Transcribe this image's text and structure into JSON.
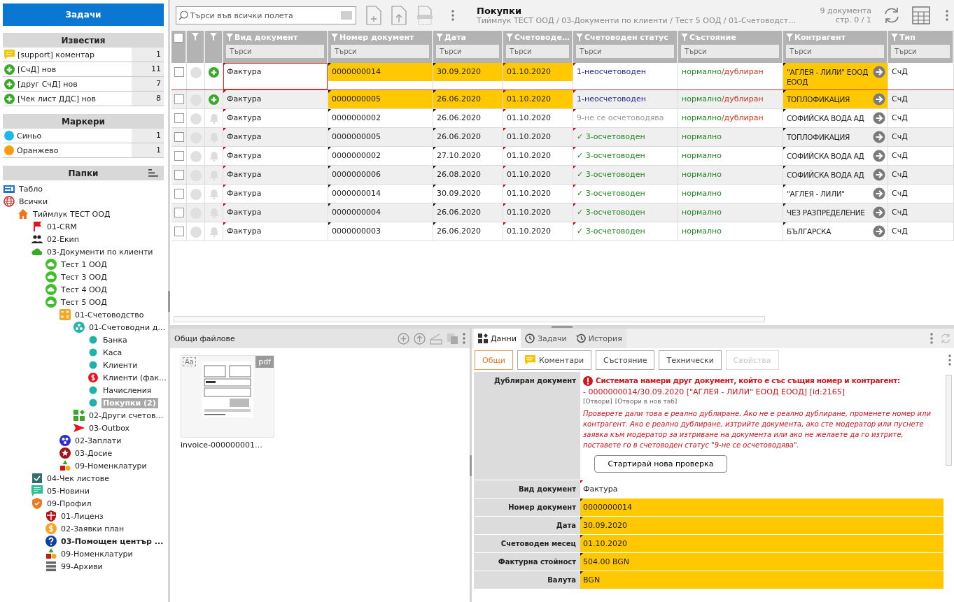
{
  "tasks_button": "Задачи",
  "notifications": {
    "title": "Известия",
    "items": [
      {
        "kind": "comment",
        "label": "[support] коментар",
        "count": "1"
      },
      {
        "kind": "new",
        "label": "[СчД] нов",
        "count": "11"
      },
      {
        "kind": "new",
        "label": "[друг СчД] нов",
        "count": "7"
      },
      {
        "kind": "new",
        "label": "[Чек лист ДДС] нов",
        "count": "8"
      }
    ]
  },
  "markers": {
    "title": "Маркери",
    "items": [
      {
        "label": "Синьо",
        "count": "1",
        "color": "#1ab8ef"
      },
      {
        "label": "Оранжево",
        "count": "1",
        "color": "#ff9a0e"
      }
    ]
  },
  "folders": {
    "title": "Папки",
    "tree": [
      {
        "label": "Табло",
        "kind": "dashboard",
        "selected": false,
        "bold": false
      },
      {
        "label": "Всички",
        "kind": "globe",
        "selected": false,
        "bold": false,
        "children": [
          {
            "label": "Тиймлук ТЕСТ ООД",
            "kind": "home",
            "selected": false,
            "bold": false,
            "children": [
              {
                "label": "01-CRM",
                "kind": "flag",
                "selected": false,
                "bold": false
              },
              {
                "label": "02-Екип",
                "kind": "team",
                "selected": false,
                "bold": false
              },
              {
                "label": "03-Документи по клиенти",
                "kind": "cloud",
                "selected": false,
                "bold": false,
                "children": [
                  {
                    "label": "Тест 1 ООД",
                    "kind": "cloud-badge",
                    "selected": false,
                    "bold": false
                  },
                  {
                    "label": "Тест 3 ООД",
                    "kind": "cloud-badge",
                    "selected": false,
                    "bold": false
                  },
                  {
                    "label": "Тест 4 ООД",
                    "kind": "cloud-badge",
                    "selected": false,
                    "bold": false
                  },
                  {
                    "label": "Тест 5 ООД",
                    "kind": "cloud-badge",
                    "selected": false,
                    "bold": false,
                    "children": [
                      {
                        "label": "01-Счетоводство",
                        "kind": "calculator",
                        "selected": false,
                        "bold": false,
                        "children": [
                          {
                            "label": "01-Счетоводни д…",
                            "kind": "cluster",
                            "selected": false,
                            "bold": false,
                            "children": [
                              {
                                "label": "Банка",
                                "kind": "dot",
                                "selected": false,
                                "bold": false
                              },
                              {
                                "label": "Каса",
                                "kind": "dot",
                                "selected": false,
                                "bold": false
                              },
                              {
                                "label": "Клиенти",
                                "kind": "dot",
                                "selected": false,
                                "bold": false
                              },
                              {
                                "label": "Клиенти (фак…",
                                "kind": "dollar-alert",
                                "selected": false,
                                "bold": false
                              },
                              {
                                "label": "Начисления",
                                "kind": "dot",
                                "selected": false,
                                "bold": false
                              },
                              {
                                "label": "Покупки (2)",
                                "kind": "dot",
                                "selected": true,
                                "bold": true
                              }
                            ]
                          },
                          {
                            "label": "02-Други счетов…",
                            "kind": "blocks",
                            "selected": false,
                            "bold": false
                          },
                          {
                            "label": "03-Outbox",
                            "kind": "send",
                            "selected": false,
                            "bold": false
                          }
                        ]
                      },
                      {
                        "label": "02-Заплати",
                        "kind": "group",
                        "selected": false,
                        "bold": false
                      },
                      {
                        "label": "03-Досие",
                        "kind": "star",
                        "selected": false,
                        "bold": false
                      },
                      {
                        "label": "09-Номенклатури",
                        "kind": "shapes",
                        "selected": false,
                        "bold": false
                      }
                    ]
                  }
                ]
              },
              {
                "label": "04-Чек листове",
                "kind": "checklist",
                "selected": false,
                "bold": false
              },
              {
                "label": "05-Новини",
                "kind": "news",
                "selected": false,
                "bold": false
              },
              {
                "label": "09-Профил",
                "kind": "shield",
                "selected": false,
                "bold": false,
                "children": [
                  {
                    "label": "01-Лиценз",
                    "kind": "shield-red",
                    "selected": false,
                    "bold": false
                  },
                  {
                    "label": "02-Заявки план",
                    "kind": "coin",
                    "selected": false,
                    "bold": false
                  },
                  {
                    "label": "03-Помощен център ...",
                    "kind": "help",
                    "selected": false,
                    "bold": true
                  },
                  {
                    "label": "09-Номенклатури",
                    "kind": "shapes",
                    "selected": false,
                    "bold": false
                  },
                  {
                    "label": "99-Архиви",
                    "kind": "archive",
                    "selected": false,
                    "bold": false
                  }
                ]
              }
            ]
          }
        ]
      }
    ]
  },
  "toolbar": {
    "search_placeholder": "Търси във всички полета",
    "title": "Покупки",
    "breadcrumb": "Тиймлук ТЕСТ ООД / 03-Документи по клиенти / Тест 5 ООД / 01-Счетоводст…",
    "count": "9 документа",
    "page": "стр. 0 / 1"
  },
  "table": {
    "select_all_checked": false,
    "columns": [
      {
        "label": "Вид документ",
        "filter_placeholder": "Търси"
      },
      {
        "label": "Номер документ",
        "filter_placeholder": "Търси"
      },
      {
        "label": "Дата",
        "filter_placeholder": "Търси"
      },
      {
        "label": "Счетоводе…",
        "filter_placeholder": "Търси"
      },
      {
        "label": "Счетоводен статус",
        "filter_placeholder": "Търси"
      },
      {
        "label": "Състояние",
        "filter_placeholder": "Търси"
      },
      {
        "label": "Контрагент",
        "filter_placeholder": "Търси"
      },
      {
        "label": "Тип",
        "filter_placeholder": "Търси"
      }
    ],
    "rows": [
      {
        "checked": false,
        "selected": true,
        "highlighted": true,
        "kind": "new",
        "doc_type": "Фактура",
        "number": "0000000014",
        "date": "30.09.2020",
        "month": "01.10.2020",
        "status": {
          "text": "1-неосчетоводен",
          "kind": "unposted"
        },
        "state": "нормално",
        "state_flag": "/дублиран",
        "contractor": "\"АГЛЕЯ - ЛИЛИ\" ЕООД ЕООД",
        "type": "СчД"
      },
      {
        "checked": false,
        "selected": false,
        "highlighted": true,
        "kind": "new",
        "doc_type": "Фактура",
        "number": "0000000005",
        "date": "26.06.2020",
        "month": "01.10.2020",
        "status": {
          "text": "1-неосчетоводен",
          "kind": "unposted"
        },
        "state": "нормално",
        "state_flag": "/дублиран",
        "contractor": "ТОПЛОФИКАЦИЯ",
        "type": "СчД"
      },
      {
        "checked": false,
        "selected": false,
        "highlighted": false,
        "kind": "bell",
        "doc_type": "Фактура",
        "number": "0000000002",
        "date": "26.06.2020",
        "month": "01.10.2020",
        "status": {
          "text": "9-не се осчетоводява",
          "kind": "excluded"
        },
        "state": "нормално",
        "state_flag": "/дублиран",
        "contractor": "СОФИЙСКА ВОДА АД",
        "type": "СчД"
      },
      {
        "checked": false,
        "selected": false,
        "highlighted": false,
        "kind": "bell",
        "doc_type": "Фактура",
        "number": "0000000005",
        "date": "26.06.2020",
        "month": "01.10.2020",
        "status": {
          "text": "✓ 3-осчетоводен",
          "kind": "posted"
        },
        "state": "нормално",
        "contractor": "ТОПЛОФИКАЦИЯ",
        "type": "СчД"
      },
      {
        "checked": false,
        "selected": false,
        "highlighted": false,
        "kind": "bell",
        "doc_type": "Фактура",
        "number": "0000000002",
        "date": "27.10.2020",
        "month": "01.10.2020",
        "status": {
          "text": "✓ 3-осчетоводен",
          "kind": "posted"
        },
        "state": "нормално",
        "contractor": "СОФИЙСКА ВОДА АД",
        "type": "СчД"
      },
      {
        "checked": false,
        "selected": false,
        "highlighted": false,
        "kind": "bell",
        "doc_type": "Фактура",
        "number": "0000000006",
        "date": "26.08.2020",
        "month": "01.10.2020",
        "status": {
          "text": "✓ 3-осчетоводен",
          "kind": "posted"
        },
        "state": "нормално",
        "contractor": "СОФИЙСКА ВОДА АД",
        "type": "СчД"
      },
      {
        "checked": false,
        "selected": false,
        "highlighted": false,
        "kind": "bell",
        "doc_type": "Фактура",
        "number": "0000000014",
        "date": "30.09.2020",
        "month": "01.10.2020",
        "status": {
          "text": "✓ 3-осчетоводен",
          "kind": "posted"
        },
        "state": "нормално",
        "contractor": "\"АГЛЕЯ - ЛИЛИ\"",
        "type": "СчД"
      },
      {
        "checked": false,
        "selected": false,
        "highlighted": false,
        "kind": "bell",
        "doc_type": "Фактура",
        "number": "0000000004",
        "date": "26.06.2020",
        "month": "01.10.2020",
        "status": {
          "text": "✓ 3-осчетоводен",
          "kind": "posted"
        },
        "state": "нормално",
        "contractor": "ЧЕЗ РАЗПРЕДЕЛЕНИЕ",
        "type": "СчД"
      },
      {
        "checked": false,
        "selected": false,
        "highlighted": false,
        "kind": "bell",
        "doc_type": "Фактура",
        "number": "0000000003",
        "date": "26.06.2020",
        "month": "01.10.2020",
        "status": {
          "text": "✓ 3-осчетоводен",
          "kind": "posted"
        },
        "state": "нормално",
        "contractor": "БЪЛГАРСКА",
        "type": "СчД"
      }
    ]
  },
  "files": {
    "title": "Общи файлове",
    "items": [
      {
        "name": "invoice-000000001…",
        "badge": "pdf",
        "ocr_label": "Aa"
      }
    ]
  },
  "details": {
    "tabs": [
      {
        "label": "Данни",
        "kind": "data",
        "selected": true
      },
      {
        "label": "Задачи",
        "kind": "tasks",
        "selected": false
      },
      {
        "label": "История",
        "kind": "history",
        "selected": false
      }
    ],
    "subtabs": [
      {
        "label": "Общи",
        "selected": true,
        "disabled": false
      },
      {
        "label": "Коментари",
        "selected": false,
        "disabled": false,
        "kind": "comment"
      },
      {
        "label": "Състояние",
        "selected": false,
        "disabled": false
      },
      {
        "label": "Технически",
        "selected": false,
        "disabled": false
      },
      {
        "label": "Свойства",
        "selected": false,
        "disabled": true
      }
    ],
    "duplicate": {
      "label": "Дублиран документ",
      "title": "Системата намери друг документ, който е със същия номер и контрагент:",
      "reference": "- 0000000014/30.09.2020 [\"АГЛЕЯ - ЛИЛИ\" ЕООД ЕООД] [id:2165]",
      "links": [
        "[Отвори]",
        "[Отвори в нов таб]"
      ],
      "message": "Проверете дали това е реално дублиране. Ако не е реално дублиране, променете номер или контрагент. Ако е реално дублиране, изтрийте документа, ако сте модератор или пуснете заявка към модератор за изтриване на документа или ако не желаете да го изтрите, поставете го в счетоводен статус \"9-не се осчетоводява\".",
      "button": "Стартирай нова проверка"
    },
    "fields": [
      {
        "label": "Вид документ",
        "value": "Фактура",
        "highlighted": false
      },
      {
        "label": "Номер документ",
        "value": "0000000014",
        "highlighted": true
      },
      {
        "label": "Дата",
        "value": "30.09.2020",
        "highlighted": true
      },
      {
        "label": "Счетоводен месец",
        "value": "01.10.2020",
        "highlighted": true
      },
      {
        "label": "Фактурна стойност",
        "value": "504.00 BGN",
        "highlighted": true
      },
      {
        "label": "Валута",
        "value": "BGN",
        "highlighted": true
      }
    ]
  }
}
